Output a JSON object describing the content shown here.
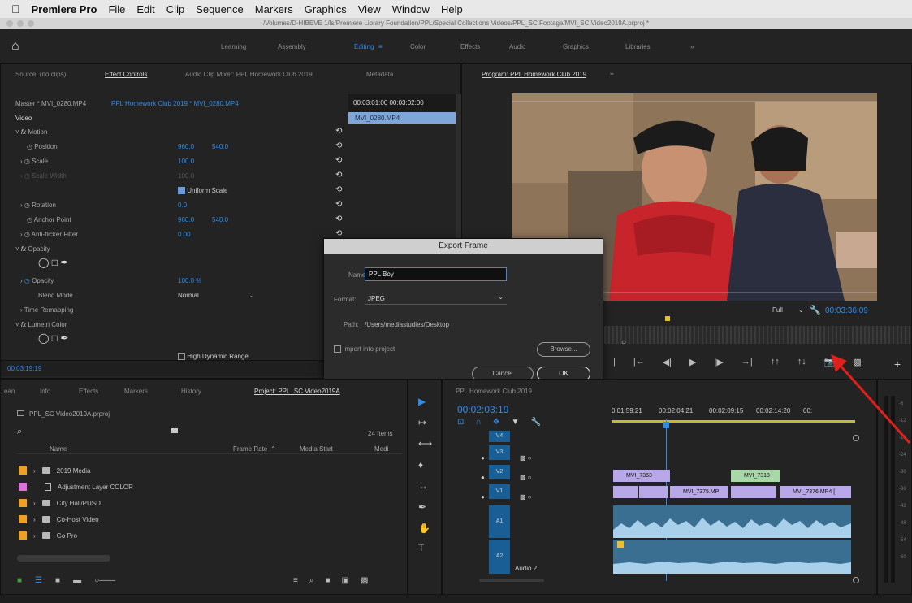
{
  "menubar": {
    "app": "Premiere Pro",
    "items": [
      "File",
      "Edit",
      "Clip",
      "Sequence",
      "Markers",
      "Graphics",
      "View",
      "Window",
      "Help"
    ]
  },
  "titlebar": {
    "path": "/Volumes/D-HIBEVE 1/ls/Premiere Library Foundation/PPL/Special Collections Videos/PPL_SC Footage/MVI_SC Video2019A.prproj *"
  },
  "workspaces": {
    "tabs": [
      "Learning",
      "Assembly",
      "Editing",
      "Color",
      "Effects",
      "Audio",
      "Graphics",
      "Libraries",
      "»"
    ],
    "active": "Editing"
  },
  "source_panel": {
    "tabs": [
      "Source: (no clips)",
      "Effect Controls",
      "Audio Clip Mixer: PPL Homework Club 2019",
      "Metadata"
    ],
    "master": "Master * MVI_0280.MP4",
    "sequence_link": "PPL Homework Club 2019 * MVI_0280.MP4",
    "video_label": "Video",
    "timecodes": "00:03:01:00   00:03:02:00",
    "clip_name": "MVI_0280.MP4",
    "current_time": "00:03:19:19",
    "effects": [
      {
        "name": "Motion",
        "indent": 0,
        "fx": true
      },
      {
        "name": "Position",
        "value": "960.0",
        "value2": "540.0"
      },
      {
        "name": "Scale",
        "value": "100.0"
      },
      {
        "name": "Scale Width",
        "value": "100.0",
        "dim": true
      },
      {
        "name": "Uniform Scale",
        "checkbox": true
      },
      {
        "name": "Rotation",
        "value": "0.0"
      },
      {
        "name": "Anchor Point",
        "value": "960.0",
        "value2": "540.0"
      },
      {
        "name": "Anti-flicker Filter",
        "value": "0.00"
      },
      {
        "name": "Opacity",
        "fx": true
      },
      {
        "name": "Opacity",
        "value": "100.0 %"
      },
      {
        "name": "Blend Mode",
        "value": "Normal",
        "dropdown": true
      },
      {
        "name": "Time Remapping"
      },
      {
        "name": "Lumetri Color",
        "fx": true
      }
    ],
    "high_dynamic_range": "High Dynamic Range"
  },
  "program": {
    "title": "Program: PPL Homework Club 2019",
    "fit": "Full",
    "duration": "00:03:36:09"
  },
  "dialog": {
    "title": "Export Frame",
    "name_label": "Name:",
    "name_value": "PPL Boy",
    "format_label": "Format:",
    "format_value": "JPEG",
    "path_label": "Path:",
    "path_value": "/Users/mediastudies/Desktop",
    "import_label": "Import into project",
    "browse": "Browse...",
    "cancel": "Cancel",
    "ok": "OK"
  },
  "project": {
    "tabs": [
      "ean",
      "Info",
      "Effects",
      "Markers",
      "History",
      "Project: PPL_SC Video2019A"
    ],
    "file": "PPL_SC Video2019A.prproj",
    "items_count": "24 Items",
    "columns": [
      "Name",
      "Frame Rate",
      "Media Start",
      "Medi"
    ],
    "rows": [
      {
        "name": "2019 Media",
        "color": "#f0a020",
        "type": "folder"
      },
      {
        "name": "Adjustment Layer COLOR",
        "color": "#e070e0",
        "type": "file"
      },
      {
        "name": "City Hall/PUSD",
        "color": "#f0a020",
        "type": "folder"
      },
      {
        "name": "Co-Host Video",
        "color": "#f0a020",
        "type": "folder"
      },
      {
        "name": "Go Pro",
        "color": "#f0a020",
        "type": "folder"
      }
    ]
  },
  "timeline": {
    "title": "PPL Homework Club 2019",
    "timecode": "00:02:03:19",
    "ruler": [
      "0:01:59:21",
      "00:02:04:21",
      "00:02:09:15",
      "00:02:14:20",
      "00:"
    ],
    "tracks": [
      "V4",
      "V3",
      "V2",
      "V1",
      "A1",
      "A2"
    ],
    "audio2_label": "Audio 2",
    "clips": [
      {
        "name": "MVI_7363",
        "track": "V2",
        "color": "#b8a8e8"
      },
      {
        "name": "MVI_7318",
        "track": "V2",
        "color": "#a8d8a8"
      },
      {
        "name": "MVI_7375.MP",
        "track": "V1",
        "color": "#b8a8e8"
      },
      {
        "name": "MVI_7376.MP4 [",
        "track": "V1",
        "color": "#b8a8e8"
      }
    ]
  },
  "colors": {
    "accent": "#2d8ceb",
    "panel": "#232323",
    "arrow": "#e0201a"
  }
}
